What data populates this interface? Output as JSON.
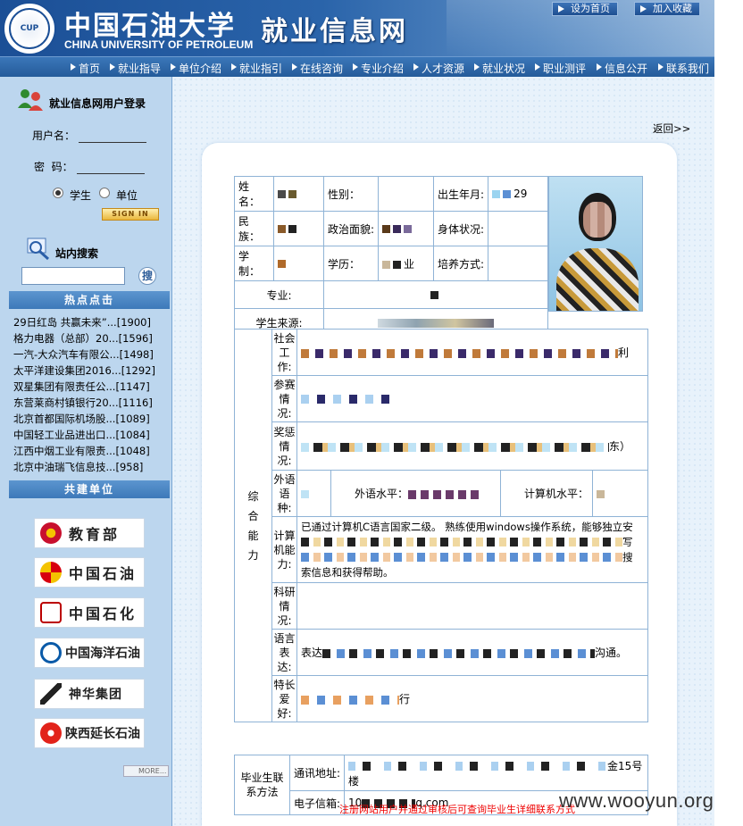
{
  "header": {
    "logo_text": "CUP",
    "cn_name": "中国石油大学",
    "en_name": "CHINA UNIVERSITY OF PETROLEUM",
    "site_name": "就业信息网",
    "set_home": "设为首页",
    "add_fav": "加入收藏"
  },
  "nav": [
    "首页",
    "就业指导",
    "单位介绍",
    "就业指引",
    "在线咨询",
    "专业介绍",
    "人才资源",
    "就业状况",
    "职业测评",
    "信息公开",
    "联系我们"
  ],
  "login": {
    "title": "就业信息网用户登录",
    "username_label": "用户名：",
    "password_label": "密  码：",
    "role_student": "学生",
    "role_unit": "单位",
    "signin": "SIGN IN"
  },
  "search": {
    "title": "站内搜索",
    "button": "搜"
  },
  "hot": {
    "title": "热点点击",
    "items": [
      "29日红岛 共赢未来”...[1900]",
      "格力电器（总部）20...[1596]",
      "一汽-大众汽车有限公...[1498]",
      "太平洋建设集团2016...[1292]",
      "双星集团有限责任公...[1147]",
      "东营莱商村镇银行20...[1116]",
      "北京首都国际机场股...[1089]",
      "中国轻工业品进出口...[1084]",
      "江西中烟工业有限责...[1048]",
      "北京中油瑞飞信息技...[958]"
    ]
  },
  "partners": {
    "title": "共建单位",
    "items": [
      "教育部",
      "中国石油",
      "中国石化",
      "中国海洋石油",
      "神华集团",
      "陕西延长石油"
    ],
    "more": "MORE..."
  },
  "main": {
    "back": "返回>>",
    "labels": {
      "name": "姓名：",
      "gender": "性别：",
      "birth": "出生年月:",
      "nation": "民族：",
      "politics": "政治面貌:",
      "health": "身体状况:",
      "duration": "学制：",
      "degree": "学历：",
      "training": "培养方式:",
      "major": "专业:",
      "source": "学生来源:",
      "ability": "综合能力",
      "social": "社会工作:",
      "contest": "参赛情况:",
      "award": "奖惩情况:",
      "lang": "外语语种:",
      "lang_level": "外语水平：",
      "computer_level": "计算机水平：",
      "computer": "计算机能力:",
      "research": "科研情况:",
      "expression": "语言表达:",
      "hobby": "特长爱好:",
      "contact": "毕业生联系方法",
      "address": "通讯地址:",
      "email": "电子信箱:"
    },
    "values": {
      "birth_tail": "29",
      "degree_tail": "业",
      "social_tail": "利",
      "award_tail": "东）",
      "computer_text_1": "已通过计算机C语言国家二级。 熟练使用windows操作系统，能够独立安",
      "computer_tail_2": "写",
      "computer_tail_3": "搜",
      "computer_text_4": "索信息和获得帮助。",
      "expression_head": "表达",
      "expression_tail": "沟通。",
      "hobby_tail": "行",
      "address_tail": "金15号楼",
      "email_head": "10",
      "email_tail": "q.com"
    },
    "notice": "注册网站用户并通过审核后可查询毕业生详细联系方式"
  },
  "watermark": "www.wooyun.org"
}
